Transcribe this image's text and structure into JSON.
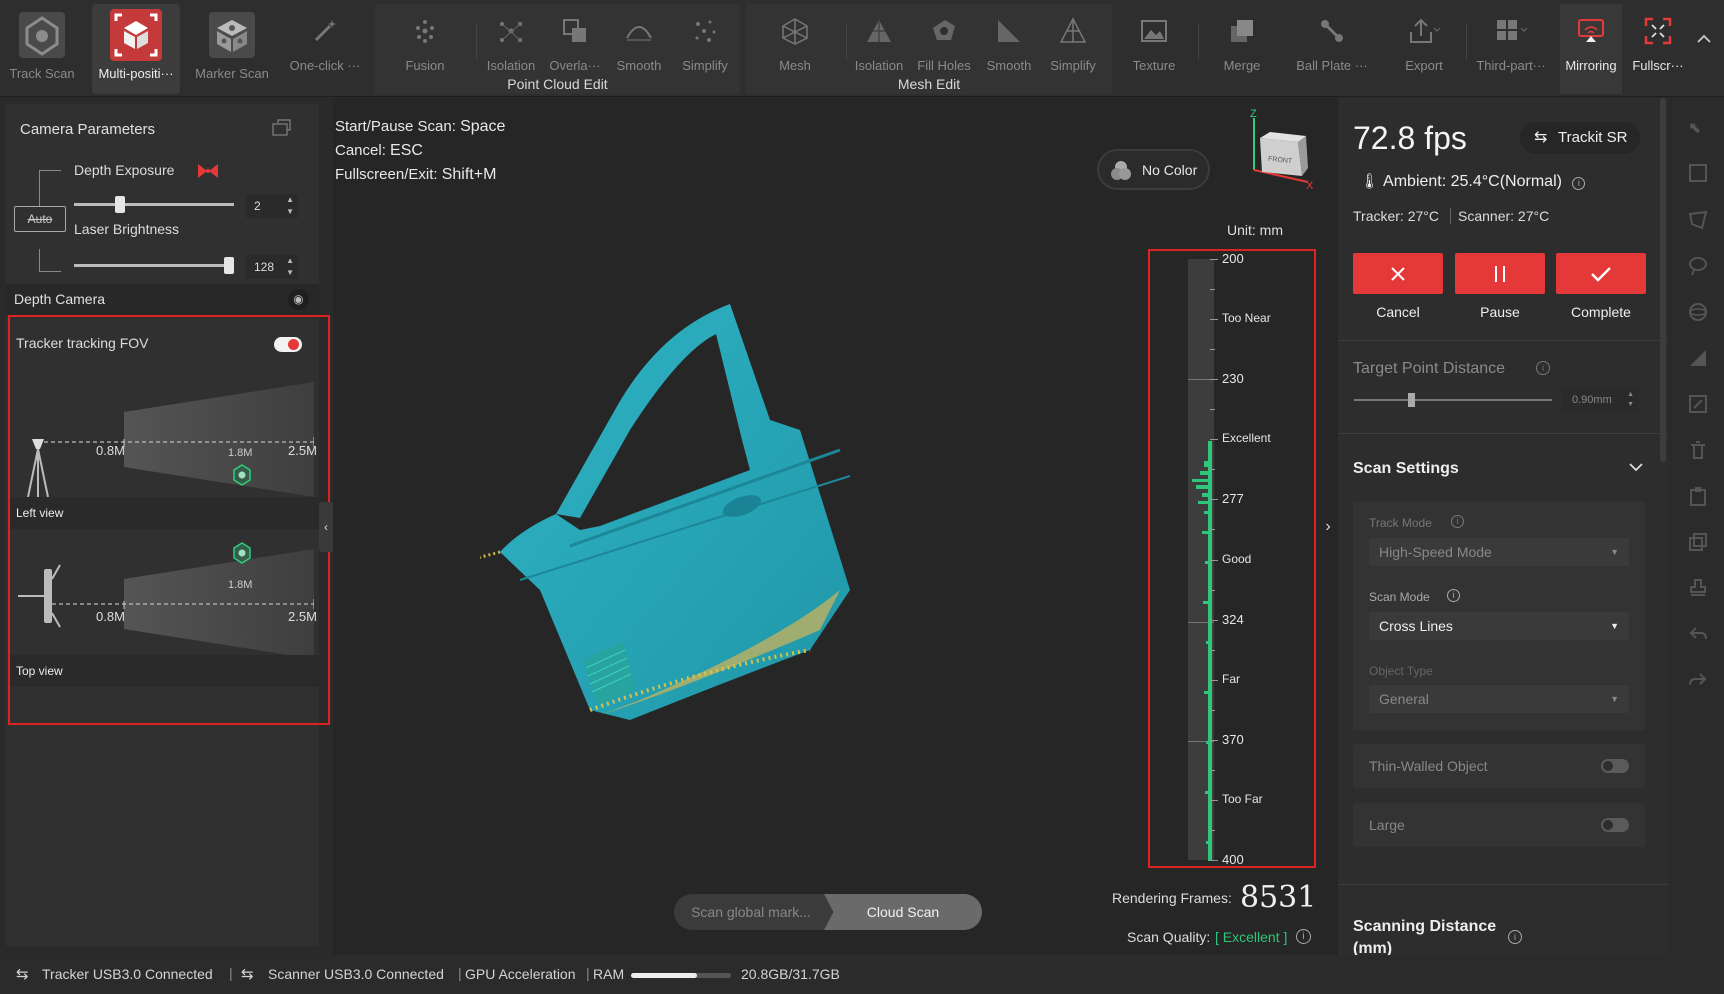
{
  "toolbar": {
    "track_scan": "Track Scan",
    "multi_position": "Multi-positi···",
    "marker_scan": "Marker Scan",
    "one_click": "One-click ···",
    "pc_fusion": "Fusion",
    "pc_isolation": "Isolation",
    "pc_overlap": "Overla···",
    "pc_smooth": "Smooth",
    "pc_simplify": "Simplify",
    "point_cloud_edit": "Point Cloud Edit",
    "mesh": "Mesh",
    "mesh_isolation": "Isolation",
    "fill_holes": "Fill Holes",
    "mesh_smooth": "Smooth",
    "mesh_simplify": "Simplify",
    "mesh_edit": "Mesh Edit",
    "texture": "Texture",
    "merge": "Merge",
    "ball_plate": "Ball Plate ···",
    "export": "Export",
    "third_party": "Third-part···",
    "mirroring": "Mirroring",
    "fullscreen": "Fullscr···",
    "accent": "#e53838"
  },
  "left": {
    "camera_parameters": "Camera Parameters",
    "depth_exposure": "Depth Exposure",
    "depth_exposure_value": "2",
    "depth_exposure_level": 0.27,
    "auto_label": "Auto",
    "laser_brightness": "Laser Brightness",
    "laser_brightness_value": "128",
    "laser_brightness_level": 1.0,
    "depth_camera": "Depth Camera",
    "tracker_fov": "Tracker tracking FOV",
    "tracker_fov_on": true,
    "left_view": "Left view",
    "top_view": "Top view",
    "near": "0.8M",
    "mid": "1.8M",
    "far": "2.5M"
  },
  "center": {
    "hint_scan_key": "Start/Pause Scan:",
    "hint_scan_val": "Space",
    "hint_cancel_key": "Cancel:",
    "hint_cancel_val": "ESC",
    "hint_full_key": "Fullscreen/Exit:",
    "hint_full_val": "Shift+M",
    "no_color": "No Color",
    "cube_face": "FRONT",
    "axis_z": "Z",
    "axis_x": "X",
    "unit": "Unit: mm",
    "scale": [
      "200",
      "Too Near",
      "230",
      "Excellent",
      "277",
      "Good",
      "324",
      "Far",
      "370",
      "Too Far",
      "400"
    ],
    "scan_global_marker": "Scan global mark...",
    "cloud_scan": "Cloud Scan",
    "rendering_frames_label": "Rendering Frames:",
    "rendering_frames": "8531",
    "scan_quality_label": "Scan Quality:",
    "scan_quality": "[ Excellent ]"
  },
  "right": {
    "fps": "72.8 fps",
    "trackit": "Trackit SR",
    "ambient": "Ambient: 25.4°C(Normal)",
    "tracker_temp": "Tracker: 27°C",
    "scanner_temp": "Scanner: 27°C",
    "cancel": "Cancel",
    "pause": "Pause",
    "complete": "Complete",
    "target_point_distance": "Target Point Distance",
    "target_point_value": "0.90mm",
    "scan_settings": "Scan Settings",
    "track_mode_label": "Track Mode",
    "track_mode": "High-Speed Mode",
    "scan_mode_label": "Scan Mode",
    "scan_mode": "Cross Lines",
    "object_type_label": "Object Type",
    "object_type": "General",
    "thin_walled": "Thin-Walled Object",
    "large": "Large",
    "scanning_distance": "Scanning Distance (mm)"
  },
  "status": {
    "tracker": "Tracker USB3.0 Connected",
    "scanner": "Scanner USB3.0 Connected",
    "gpu": "GPU Acceleration",
    "ram": "RAM",
    "ram_usage": "20.8GB/31.7GB",
    "ram_fraction": 0.656
  }
}
